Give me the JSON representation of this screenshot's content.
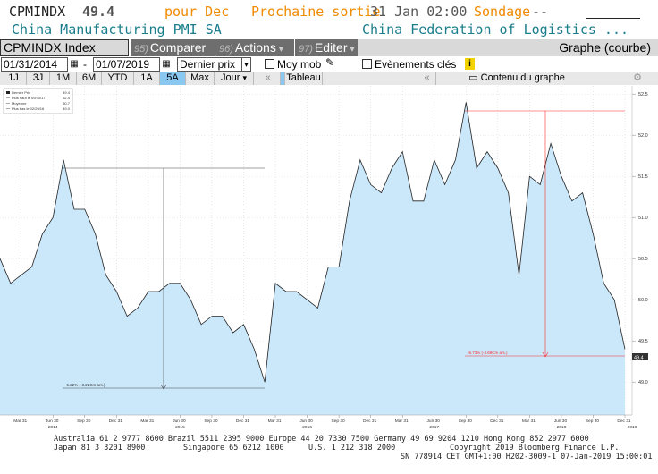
{
  "header": {
    "ticker": "CPMINDX",
    "value": "49.4",
    "period_label": "pour Dec",
    "next_release_label": "Prochaine sortie",
    "next_release_date": "31 Jan 02:00",
    "survey_label": "Sondage",
    "survey_value": "--",
    "index_name": "China Manufacturing PMI SA",
    "source": "China Federation of Logistics ..."
  },
  "toolbar": {
    "security": "CPMINDX Index",
    "compare_num": "95)",
    "compare_label": "Comparer",
    "actions_num": "96)",
    "actions_label": "Actions",
    "edit_num": "97)",
    "edit_label": "Editer",
    "graph_label": "Graphe (courbe)"
  },
  "controls": {
    "start_date": "01/31/2014",
    "end_date": "01/07/2019",
    "price_type": "Dernier prix",
    "moy_mob_label": "Moy mob",
    "events_label": "Evènements clés"
  },
  "periods": [
    "1J",
    "3J",
    "1M",
    "6M",
    "YTD",
    "1A",
    "5A",
    "Max"
  ],
  "active_period": "5A",
  "frequency": "Jour",
  "table_label": "Tableau",
  "content_label": "Contenu du graphe",
  "colors": {
    "area": "#cbe8fb",
    "line": "#222222",
    "active": "#8ac8f2",
    "orange": "#f08a00",
    "marker_red": "#ff2a2a"
  },
  "legend": {
    "rows": [
      {
        "label": "Dernier Prix",
        "value": "49.4"
      },
      {
        "label": "Plus haut le 09/30/17",
        "value": "52.4"
      },
      {
        "label": "Moyenne",
        "value": "50.7"
      },
      {
        "label": "Plus bas le 02/29/16",
        "value": "49.0"
      }
    ]
  },
  "annotations": {
    "left_drop": "-5.22% (-3.22Cm ars.)",
    "right_drop": "-5.73% (-4.69Cm ars.)",
    "last_value": "49.4"
  },
  "chart_data": {
    "type": "area",
    "x": [
      "2014-01",
      "2014-02",
      "2014-03",
      "2014-04",
      "2014-05",
      "2014-06",
      "2014-07",
      "2014-08",
      "2014-09",
      "2014-10",
      "2014-11",
      "2014-12",
      "2015-01",
      "2015-02",
      "2015-03",
      "2015-04",
      "2015-05",
      "2015-06",
      "2015-07",
      "2015-08",
      "2015-09",
      "2015-10",
      "2015-11",
      "2015-12",
      "2016-01",
      "2016-02",
      "2016-03",
      "2016-04",
      "2016-05",
      "2016-06",
      "2016-07",
      "2016-08",
      "2016-09",
      "2016-10",
      "2016-11",
      "2016-12",
      "2017-01",
      "2017-02",
      "2017-03",
      "2017-04",
      "2017-05",
      "2017-06",
      "2017-07",
      "2017-08",
      "2017-09",
      "2017-10",
      "2017-11",
      "2017-12",
      "2018-01",
      "2018-02",
      "2018-03",
      "2018-04",
      "2018-05",
      "2018-06",
      "2018-07",
      "2018-08",
      "2018-09",
      "2018-10",
      "2018-11",
      "2018-12"
    ],
    "values": [
      50.5,
      50.2,
      50.3,
      50.4,
      50.8,
      51.0,
      51.7,
      51.1,
      51.1,
      50.8,
      50.3,
      50.1,
      49.8,
      49.9,
      50.1,
      50.1,
      50.2,
      50.2,
      50.0,
      49.7,
      49.8,
      49.8,
      49.6,
      49.7,
      49.4,
      49.0,
      50.2,
      50.1,
      50.1,
      50.0,
      49.9,
      50.4,
      50.4,
      51.2,
      51.7,
      51.4,
      51.3,
      51.6,
      51.8,
      51.2,
      51.2,
      51.7,
      51.4,
      51.7,
      52.4,
      51.6,
      51.8,
      51.6,
      51.3,
      50.3,
      51.5,
      51.4,
      51.9,
      51.5,
      51.2,
      51.3,
      50.8,
      50.2,
      50.0,
      49.4
    ],
    "ylim": [
      48.6,
      52.6
    ],
    "yticks": [
      "52.5",
      "52.0",
      "51.5",
      "51.0",
      "50.5",
      "50.0",
      "49.5",
      "49.0"
    ],
    "xtick_labels": [
      "Mar 31",
      "Jun 30",
      "Sep 30",
      "Dec 31",
      "Mar 31",
      "Jun 30",
      "Sep 30",
      "Dec 31",
      "Mar 31",
      "Jun 30",
      "Sep 30",
      "Dec 31",
      "Mar 31",
      "Jun 30",
      "Sep 30",
      "Dec 31",
      "Mar 31",
      "Jun 30",
      "Sep 30",
      "Dec 31"
    ],
    "year_labels": [
      "2014",
      "2015",
      "2016",
      "2017",
      "2018",
      "2019"
    ]
  },
  "footer": {
    "line1": "Australia 61 2 9777 8600 Brazil 5511 2395 9000 Europe 44 20 7330 7500 Germany 49 69 9204 1210 Hong Kong 852 2977 6000",
    "line2a": "Japan 81 3 3201 8900",
    "line2b": "Singapore 65 6212 1000",
    "line2c": "U.S. 1 212 318 2000",
    "line2d": "Copyright 2019 Bloomberg Finance L.P.",
    "line3": "SN 778914 CET  GMT+1:00 H202-3009-1 07-Jan-2019 15:00:01"
  }
}
